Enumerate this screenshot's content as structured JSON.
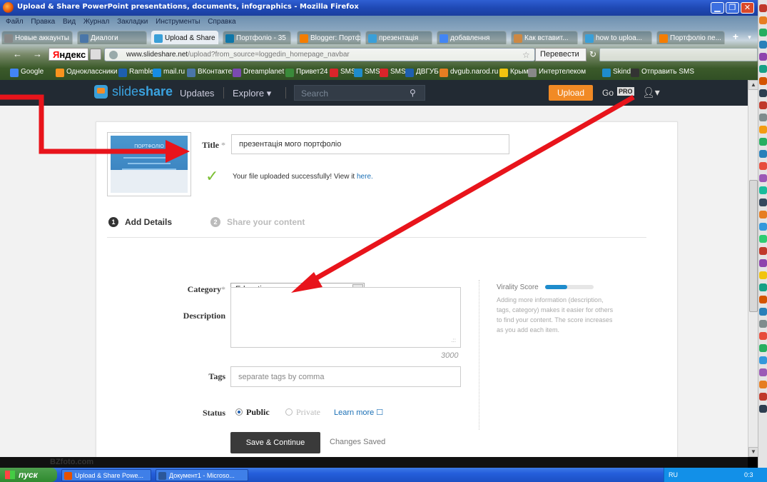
{
  "window": {
    "title": "Upload & Share PowerPoint presentations, documents, infographics - Mozilla Firefox"
  },
  "menu": [
    "Файл",
    "Правка",
    "Вид",
    "Журнал",
    "Закладки",
    "Инструменты",
    "Справка"
  ],
  "tabs": [
    {
      "label": "Новые аккаунты",
      "color": "#888888"
    },
    {
      "label": "Диалоги",
      "color": "#4a76a8"
    },
    {
      "label": "Upload & Share",
      "color": "#3a9fd8",
      "active": true
    },
    {
      "label": "Портфоліо - 35",
      "color": "#0e76a8"
    },
    {
      "label": "Blogger: Портф...",
      "color": "#f57d00"
    },
    {
      "label": "презентація",
      "color": "#3a9fd8"
    },
    {
      "label": "добавлення",
      "color": "#4285f4"
    },
    {
      "label": "Как вставит...",
      "color": "#cc8844"
    },
    {
      "label": "how to uploa...",
      "color": "#3a9fd8"
    },
    {
      "label": "Портфоліо пе...",
      "color": "#f57d00"
    }
  ],
  "nav": {
    "yandex_y": "Я",
    "yandex_rest": "ндекс",
    "url_host": "www.slideshare.net",
    "url_path": "/upload?from_source=loggedin_homepage_navbar",
    "translate_label": "Перевести"
  },
  "bookmarks": [
    {
      "label": "Google",
      "color": "#4285f4"
    },
    {
      "label": "Одноклассники",
      "color": "#f7931e"
    },
    {
      "label": "Rambler",
      "color": "#1e5fb0"
    },
    {
      "label": "mail.ru",
      "color": "#168de2"
    },
    {
      "label": "ВКонтакте",
      "color": "#4a76a8"
    },
    {
      "label": "Dreamplanet",
      "color": "#7a4ab0"
    },
    {
      "label": "Привет24",
      "color": "#3a8a3a"
    },
    {
      "label": "SMS",
      "color": "#d9252a"
    },
    {
      "label": "SMS",
      "color": "#1e8ccc"
    },
    {
      "label": "SMS",
      "color": "#d9252a"
    },
    {
      "label": "ДВГУБ",
      "color": "#1e5fb0"
    },
    {
      "label": "dvgub.narod.ru",
      "color": "#e67e22"
    },
    {
      "label": "Крым",
      "color": "#f1c40f"
    },
    {
      "label": "Интертелеком",
      "color": "#888888"
    },
    {
      "label": "Skindo",
      "color": "#1e8ccc"
    },
    {
      "label": "Отправить SMS",
      "color": "#333333"
    }
  ],
  "header": {
    "logo_light": "slide",
    "logo_bold": "share",
    "updates": "Updates",
    "explore": "Explore ▾",
    "search_placeholder": "Search",
    "upload": "Upload",
    "go": "Go",
    "pro": "PRO",
    "user_icon": "user-icon"
  },
  "thumbnail": {
    "title": "ПОРТФОЛІО"
  },
  "form": {
    "title_label": "Title",
    "required_mark": "*",
    "title_value": "презентація мого портфоліо",
    "success_text": "Your file uploaded successfully! View it",
    "success_link": "here.",
    "step1_num": "1",
    "step1_label": "Add Details",
    "step2_num": "2",
    "step2_label": "Share your content",
    "category_label": "Category",
    "category_value": "Education",
    "description_label": "Description",
    "description_value": "",
    "char_counter": "3000",
    "tags_label": "Tags",
    "tags_placeholder": "separate tags by comma",
    "status_label": "Status",
    "status_public": "Public",
    "status_private": "Private",
    "learn_more": "Learn more ☐",
    "save_button": "Save & Continue",
    "changes_saved": "Changes Saved",
    "virality_label": "Virality Score",
    "virality_value": 0.45,
    "virality_desc": "Adding more information (description, tags, category) makes it easier for others to find your content. The score increases as you add each item."
  },
  "colors": {
    "accent": "#f18a25",
    "brand_blue": "#3aa3e0",
    "annotation_arrow": "#e8141b",
    "success_green": "#7bbf33"
  },
  "watermark": "BZfoto.com",
  "taskbar": {
    "start": "пуск",
    "tasks": [
      {
        "label": "Upload & Share Powe...",
        "color": "#e65100"
      },
      {
        "label": "Документ1 - Microso...",
        "color": "#2b579a"
      }
    ],
    "lang": "RU",
    "clock": "0:3"
  }
}
